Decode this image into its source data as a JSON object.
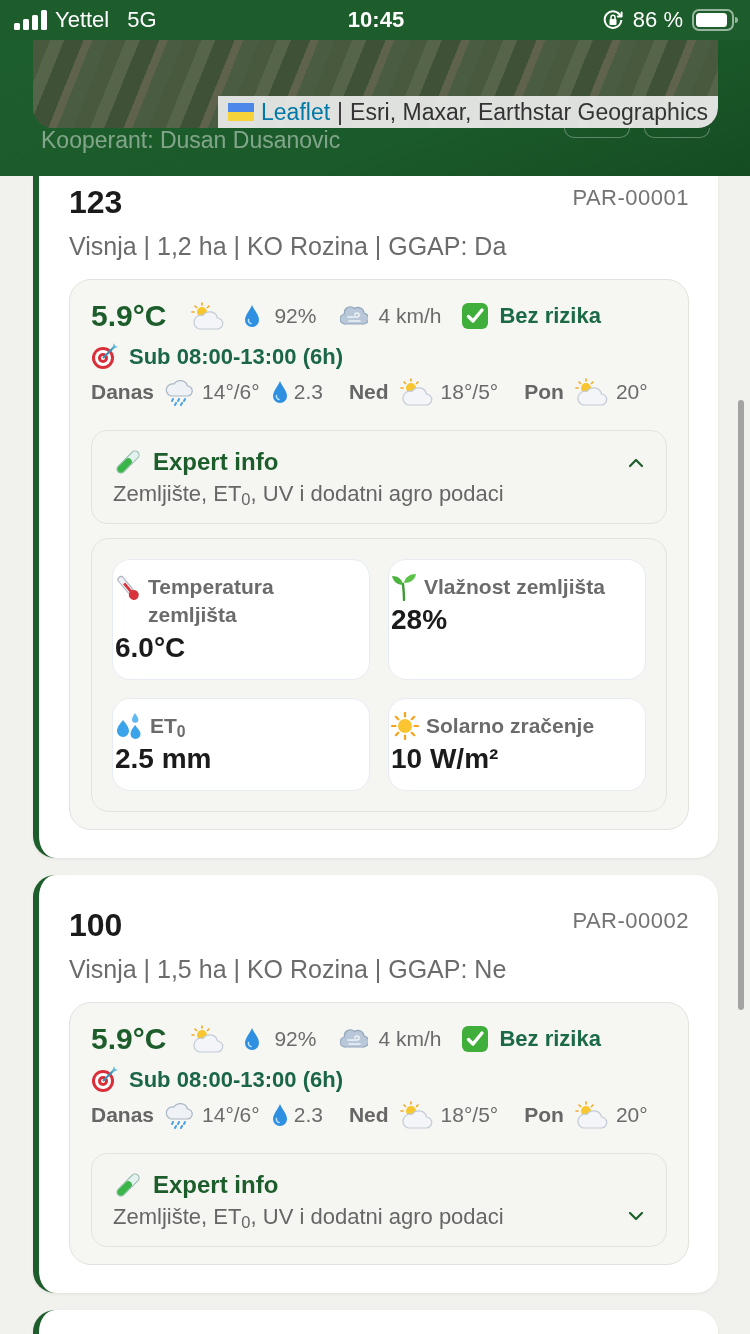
{
  "status_bar": {
    "carrier": "Yettel",
    "network": "5G",
    "time": "10:45",
    "battery": "86 %"
  },
  "header": {
    "map": {
      "attribution_link": "Leaflet",
      "attribution_separator": "|",
      "attribution": "Esri, Maxar, Earthstar Geographics"
    },
    "farmer": "Kooperant: Dusan Dusanovic"
  },
  "parcels": [
    {
      "name": "123",
      "code": "PAR-00001",
      "details": "Visnja | 1,2 ha | KO Rozina | GGAP: Da",
      "weather": {
        "temperature": "5.9°C",
        "kind": "partly_cloudy",
        "humidity": "92%",
        "wind": "4 km/h",
        "risk": "Bez rizika",
        "spray_window": "Sub 08:00-13:00 (6h)",
        "forecast": [
          {
            "day": "Danas",
            "kind": "rain",
            "temperature": "14°/6°",
            "precipitation": "2.3"
          },
          {
            "day": "Ned",
            "kind": "partly_cloudy",
            "temperature": "18°/5°"
          },
          {
            "day": "Pon",
            "kind": "partly_cloudy",
            "temperature": "20°"
          }
        ]
      },
      "expert": {
        "title": "Expert info",
        "subtitle": "Zemljište, ET$_{0}$, UV i dodatni agro podaci",
        "expanded": true,
        "metrics": [
          {
            "kind": "soil_temperature",
            "label": "Temperatura zemljišta",
            "value": "6.0°C"
          },
          {
            "kind": "soil_moisture",
            "label": "Vlažnost zemljišta",
            "value": "28%"
          },
          {
            "kind": "et0",
            "label": "ET$_{0}$",
            "value": "2.5 mm"
          },
          {
            "kind": "solar",
            "label": "Solarno zračenje",
            "value": "10 W/m²"
          }
        ]
      }
    },
    {
      "name": "100",
      "code": "PAR-00002",
      "details": "Visnja | 1,5 ha | KO Rozina | GGAP: Ne",
      "weather": {
        "temperature": "5.9°C",
        "kind": "partly_cloudy",
        "humidity": "92%",
        "wind": "4 km/h",
        "risk": "Bez rizika",
        "spray_window": "Sub 08:00-13:00 (6h)",
        "forecast": [
          {
            "day": "Danas",
            "kind": "rain",
            "temperature": "14°/6°",
            "precipitation": "2.3"
          },
          {
            "day": "Ned",
            "kind": "partly_cloudy",
            "temperature": "18°/5°"
          },
          {
            "day": "Pon",
            "kind": "partly_cloudy",
            "temperature": "20°"
          }
        ]
      },
      "expert": {
        "title": "Expert info",
        "subtitle": "Zemljište, ET$_{0}$, UV i dodatni agro podaci",
        "expanded": false
      }
    }
  ]
}
